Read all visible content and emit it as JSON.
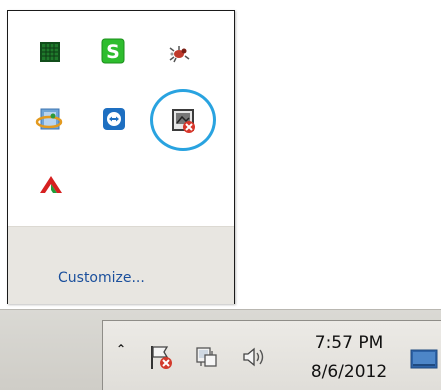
{
  "popup": {
    "customize_label": "Customize...",
    "icons": [
      "green-grid-app-icon",
      "green-s-app-icon",
      "red-bug-app-icon",
      "internet-app-icon",
      "teamviewer-icon",
      "network-error-icon",
      "red-arrow-app-icon"
    ],
    "highlight_color": "#29a3e0"
  },
  "taskbar": {
    "overflow_label": "⌃",
    "icons": [
      "action-center-flag-icon",
      "network-icon",
      "speaker-icon",
      "show-desktop-icon"
    ],
    "clock": {
      "time": "7:57 PM",
      "date": "8/6/2012"
    }
  }
}
